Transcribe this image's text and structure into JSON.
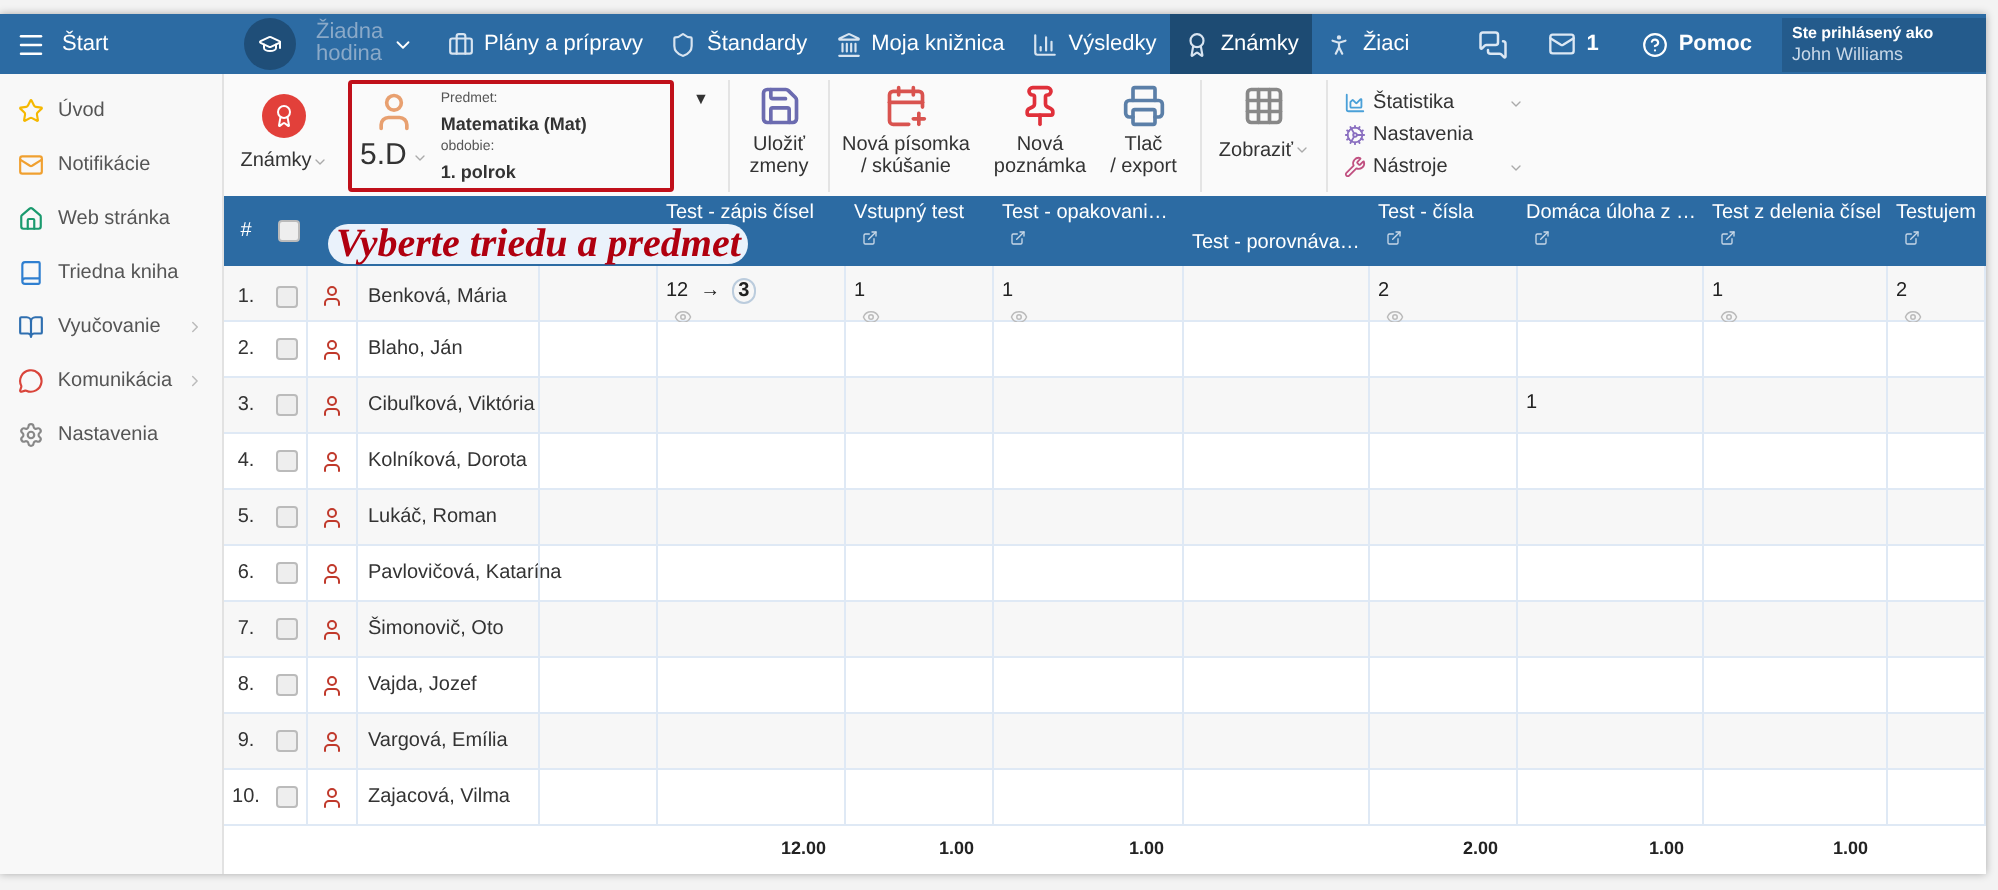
{
  "nav": {
    "menu_label": "Štart",
    "lesson": {
      "label": "Žiadna hodina",
      "disabled": true
    },
    "items": [
      {
        "label": "Plány a prípravy",
        "selected": false
      },
      {
        "label": "Štandardy",
        "selected": false
      },
      {
        "label": "Moja knižnica",
        "selected": false
      },
      {
        "label": "Výsledky",
        "selected": false
      },
      {
        "label": "Známky",
        "selected": true
      },
      {
        "label": "Žiaci",
        "selected": false
      }
    ],
    "mail_count": "1",
    "help": "Pomoc",
    "user_caption": "Ste prihlásený ako",
    "user_name": "John Williams"
  },
  "sidebar": {
    "items": [
      {
        "label": "Úvod",
        "expandable": false
      },
      {
        "label": "Notifikácie",
        "expandable": false
      },
      {
        "label": "Web stránka",
        "expandable": false
      },
      {
        "label": "Triedna kniha",
        "expandable": false
      },
      {
        "label": "Vyučovanie",
        "expandable": true
      },
      {
        "label": "Komunikácia",
        "expandable": true
      },
      {
        "label": "Nastavenia",
        "expandable": false
      }
    ]
  },
  "toolbar": {
    "mode": "Známky",
    "class": "5.D",
    "subject_label": "Predmet:",
    "subject": "Matematika (Mat)",
    "period_label": "obdobie:",
    "period": "1. polrok",
    "selector_caret": "▼",
    "buttons": [
      {
        "label": "Uložiť zmeny"
      },
      {
        "label": "Nová písomka / skúšanie"
      },
      {
        "label": "Nová poznámka"
      },
      {
        "label": "Tlač / export"
      }
    ],
    "view": "Zobraziť",
    "menu": [
      {
        "label": "Štatistika",
        "dropdown": true
      },
      {
        "label": "Nastavenia",
        "dropdown": false
      },
      {
        "label": "Nástroje",
        "dropdown": true
      }
    ]
  },
  "hint": "Vyberte triedu a predmet",
  "table": {
    "number_header": "#",
    "all_checked": false,
    "columns": [
      {
        "title": "Test - zápis čísel",
        "link": false,
        "total": "12.00"
      },
      {
        "title": "Vstupný test",
        "link": true,
        "total": "1.00"
      },
      {
        "title": "Test - opakovani…",
        "link": true,
        "total": "1.00"
      },
      {
        "title": "Test - porovnáva…",
        "link": false
      },
      {
        "title": "Test - čísla",
        "link": true,
        "total": "2.00"
      },
      {
        "title": "Domáca úloha z …",
        "link": true,
        "total": "1.00"
      },
      {
        "title": "Test z delenia čísel",
        "link": true,
        "total": "1.00"
      },
      {
        "title": "Testujem",
        "link": true
      }
    ],
    "rows": [
      {
        "number": "1.",
        "name": "Benková, Mária",
        "checked": false,
        "cells": [
          {
            "kind": "converted",
            "value": "12",
            "arrow": "→",
            "final": "3"
          },
          {
            "kind": "grade",
            "value": "1"
          },
          {
            "kind": "grade",
            "value": "1"
          },
          {
            "kind": "empty"
          },
          {
            "kind": "grade",
            "value": "2"
          },
          {
            "kind": "empty"
          },
          {
            "kind": "grade",
            "value": "1"
          },
          {
            "kind": "grade",
            "value": "2"
          }
        ]
      },
      {
        "number": "2.",
        "name": "Blaho, Ján",
        "checked": false
      },
      {
        "number": "3.",
        "name": "Cibuľková, Viktória",
        "checked": false,
        "cells": [
          {
            "kind": "empty"
          },
          {
            "kind": "empty"
          },
          {
            "kind": "empty"
          },
          {
            "kind": "empty"
          },
          {
            "kind": "empty"
          },
          {
            "kind": "plain",
            "value": "1"
          }
        ]
      },
      {
        "number": "4.",
        "name": "Kolníková, Dorota",
        "checked": false
      },
      {
        "number": "5.",
        "name": "Lukáč, Roman",
        "checked": false
      },
      {
        "number": "6.",
        "name": "Pavlovičová, Katarína",
        "checked": false
      },
      {
        "number": "7.",
        "name": "Šimonovič, Oto",
        "checked": false
      },
      {
        "number": "8.",
        "name": "Vajda, Jozef",
        "checked": false
      },
      {
        "number": "9.",
        "name": "Vargová, Emília",
        "checked": false
      },
      {
        "number": "10.",
        "name": "Zajacová, Vilma",
        "checked": false
      }
    ]
  }
}
